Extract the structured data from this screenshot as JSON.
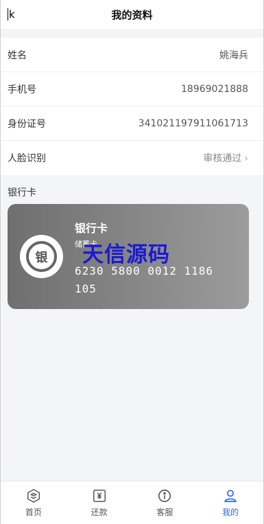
{
  "header": {
    "back_label": "k",
    "title": "我的资料"
  },
  "info": {
    "rows": [
      {
        "label": "姓名",
        "value": "姚海兵"
      },
      {
        "label": "手机号",
        "value": "18969021888"
      },
      {
        "label": "身份证号",
        "value": "341021197911061713"
      },
      {
        "label": "人脸识别",
        "value": "审核通过",
        "chevron": "›"
      }
    ]
  },
  "bank": {
    "section_title": "银行卡",
    "card_name": "银行卡",
    "card_type": "储蓄卡",
    "card_number": "6230 5800 0012 1186 105",
    "logo_text": "银"
  },
  "watermark": "天信源码",
  "tabs": [
    {
      "label": "首页",
      "icon": "home-icon"
    },
    {
      "label": "还款",
      "icon": "repay-icon"
    },
    {
      "label": "客服",
      "icon": "service-icon"
    },
    {
      "label": "我的",
      "icon": "user-icon",
      "active": true
    }
  ],
  "colors": {
    "accent": "#2e62f5",
    "watermark": "#1a1ad6"
  }
}
